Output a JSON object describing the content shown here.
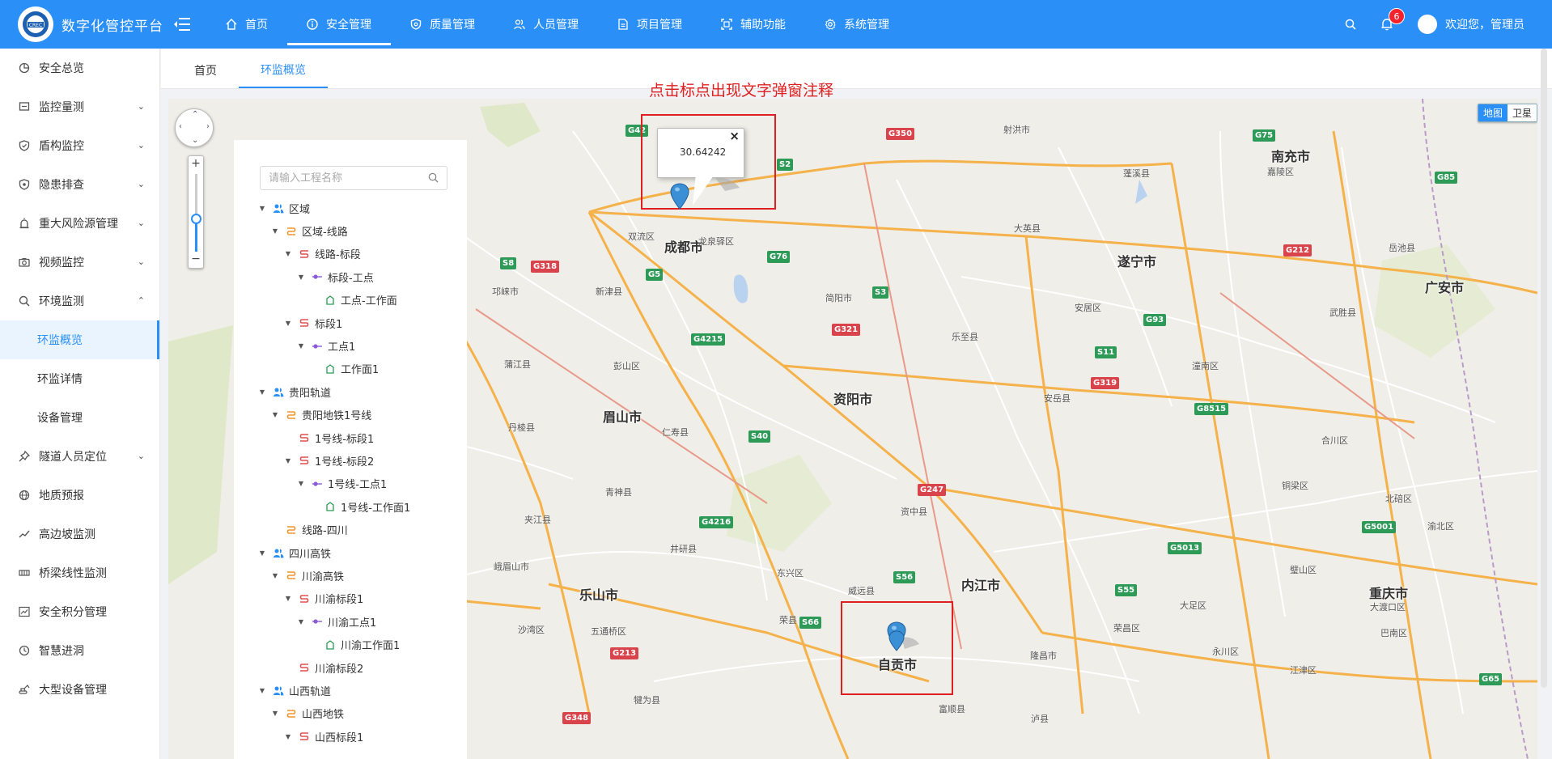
{
  "app": {
    "title": "数字化管控平台"
  },
  "nav": [
    {
      "label": "首页",
      "icon": "home-icon"
    },
    {
      "label": "安全管理",
      "icon": "info-icon",
      "active": true
    },
    {
      "label": "质量管理",
      "icon": "shield-icon"
    },
    {
      "label": "人员管理",
      "icon": "users-icon"
    },
    {
      "label": "项目管理",
      "icon": "document-icon"
    },
    {
      "label": "辅助功能",
      "icon": "expand-icon"
    },
    {
      "label": "系统管理",
      "icon": "gear-icon"
    }
  ],
  "user": {
    "notifications": "6",
    "welcome": "欢迎您，管理员"
  },
  "sidebar": {
    "items": [
      {
        "label": "安全总览"
      },
      {
        "label": "监控量测"
      },
      {
        "label": "盾构监控"
      },
      {
        "label": "隐患排查"
      },
      {
        "label": "重大风险源管理"
      },
      {
        "label": "视频监控"
      },
      {
        "label": "环境监测"
      },
      {
        "label": "隧道人员定位"
      },
      {
        "label": "地质预报"
      },
      {
        "label": "高边坡监测"
      },
      {
        "label": "桥梁线性监测"
      },
      {
        "label": "安全积分管理"
      },
      {
        "label": "智慧进洞"
      },
      {
        "label": "大型设备管理"
      }
    ],
    "sub": [
      {
        "label": "环监概览"
      },
      {
        "label": "环监详情"
      },
      {
        "label": "设备管理"
      }
    ]
  },
  "tabs": [
    {
      "label": "首页"
    },
    {
      "label": "环监概览"
    }
  ],
  "tree": {
    "search_placeholder": "请输入工程名称",
    "nodes": [
      {
        "label": "区域"
      },
      {
        "label": "区域-线路"
      },
      {
        "label": "线路-标段"
      },
      {
        "label": "标段-工点"
      },
      {
        "label": "工点-工作面"
      },
      {
        "label": "标段1"
      },
      {
        "label": "工点1"
      },
      {
        "label": "工作面1"
      },
      {
        "label": "贵阳轨道"
      },
      {
        "label": "贵阳地铁1号线"
      },
      {
        "label": "1号线-标段1"
      },
      {
        "label": "1号线-标段2"
      },
      {
        "label": "1号线-工点1"
      },
      {
        "label": "1号线-工作面1"
      },
      {
        "label": "线路-四川"
      },
      {
        "label": "四川高铁"
      },
      {
        "label": "川渝高铁"
      },
      {
        "label": "川渝标段1"
      },
      {
        "label": "川渝工点1"
      },
      {
        "label": "川渝工作面1"
      },
      {
        "label": "川渝标段2"
      },
      {
        "label": "山西轨道"
      },
      {
        "label": "山西地铁"
      },
      {
        "label": "山西标段1"
      }
    ]
  },
  "map": {
    "annotation": "点击标点出现文字弹窗注释",
    "popup_value": "30.64242",
    "type_map": "地图",
    "type_satellite": "卫星",
    "zoom_in": "+",
    "zoom_out": "−",
    "cities": [
      "成都市",
      "遂宁市",
      "南充市",
      "广安市",
      "资阳市",
      "眉山市",
      "乐山市",
      "内江市",
      "自贡市",
      "重庆市"
    ],
    "towns": [
      "双流区",
      "龙泉驿区",
      "新津县",
      "邛崃市",
      "蒲江县",
      "彭山区",
      "丹棱县",
      "仁寿县",
      "青神县",
      "夹江县",
      "井研县",
      "五通桥区",
      "犍为县",
      "沙湾区",
      "峨眉山市",
      "简阳市",
      "乐至县",
      "安岳县",
      "资中县",
      "威远县",
      "荣县",
      "富顺县",
      "隆昌市",
      "荣昌区",
      "大足区",
      "永川区",
      "江津区",
      "璧山区",
      "铜梁区",
      "合川区",
      "潼南区",
      "武胜县",
      "岳池县",
      "蓬溪县",
      "安居区",
      "大英县",
      "射洪市",
      "嘉陵区",
      "泸县",
      "沙湾区",
      "东兴区",
      "大渡口区",
      "巴南区",
      "北碚区",
      "渝北区"
    ],
    "shields": [
      {
        "t": "G42",
        "c": "g"
      },
      {
        "t": "S2",
        "c": "g"
      },
      {
        "t": "G76",
        "c": "g"
      },
      {
        "t": "G5",
        "c": "g"
      },
      {
        "t": "G4215",
        "c": "g"
      },
      {
        "t": "S40",
        "c": "g"
      },
      {
        "t": "G93",
        "c": "g"
      },
      {
        "t": "G85",
        "c": "g"
      },
      {
        "t": "G75",
        "c": "g"
      },
      {
        "t": "S3",
        "c": "g"
      },
      {
        "t": "G8515",
        "c": "g"
      },
      {
        "t": "G5013",
        "c": "g"
      },
      {
        "t": "G318",
        "c": "r"
      },
      {
        "t": "G350",
        "c": "r"
      },
      {
        "t": "G321",
        "c": "r"
      },
      {
        "t": "G319",
        "c": "r"
      },
      {
        "t": "G247",
        "c": "r"
      },
      {
        "t": "G212",
        "c": "r"
      },
      {
        "t": "G213",
        "c": "r"
      },
      {
        "t": "G348",
        "c": "r"
      },
      {
        "t": "S66",
        "c": "g"
      },
      {
        "t": "S56",
        "c": "g"
      },
      {
        "t": "S55",
        "c": "g"
      },
      {
        "t": "G4216",
        "c": "g"
      },
      {
        "t": "G5001",
        "c": "g"
      },
      {
        "t": "S11",
        "c": "g"
      },
      {
        "t": "G65",
        "c": "g"
      },
      {
        "t": "S8",
        "c": "g"
      }
    ]
  }
}
